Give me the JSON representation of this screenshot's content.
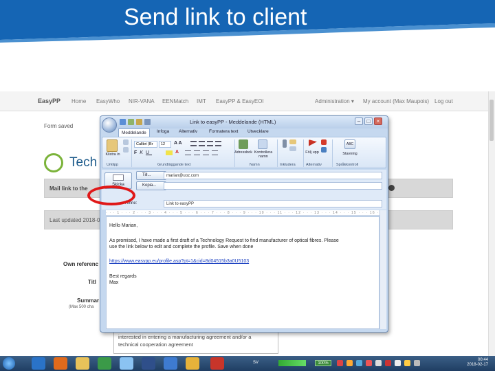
{
  "slide": {
    "title": "Send link to client",
    "colors": {
      "header_blue": "#1565b4",
      "header_light": "#4a90d0",
      "oval": "#e01818"
    }
  },
  "browser": {
    "brand": "EasyPP",
    "nav": [
      "Home",
      "EasyWho",
      "NIR-VANA",
      "EENMatch",
      "IMT",
      "EasyPP & EasyEOI",
      "Administration ▾",
      "My account (Max Maupois)",
      "Log out"
    ],
    "form_saved": "Form saved",
    "logo_text": "Tech",
    "mail_link": "Mail link to the",
    "last_updated": "Last updated 2018-0",
    "own_reference": "Own referenc",
    "title_label": "Titl",
    "summary_label": "Summar",
    "summary_hint": "(Max 500 cha",
    "summary_line1": "interested in entering a manufacturing agreement and/or a",
    "summary_line2": "technical cooperation agreement"
  },
  "outlook": {
    "title": "Link to easyPP - Meddelande (HTML)",
    "tabs": [
      "Meddelande",
      "Infoga",
      "Alternativ",
      "Formatera text",
      "Utvecklare"
    ],
    "ribbon": {
      "paste": "Klistra in",
      "font_name": "Calibri (Br",
      "font_size": "12",
      "addressbook": "Adressbok",
      "check_names": "Kontrollera namn",
      "followup": "Följ upp",
      "spelling": "Stavning",
      "groups": [
        "Urklipp",
        "Grundläggande text",
        "Namn",
        "Inkludera",
        "Alternativ",
        "Språkkontroll"
      ]
    },
    "header": {
      "send": "Skicka",
      "to_button": "Till...",
      "cc_button": "Kopia...",
      "subject_label": "Ämne:",
      "to_value": "marian@uoz.com",
      "cc_value": "",
      "subject_value": "Link to easyPP"
    },
    "body": {
      "greeting": "Hello Marian,",
      "line1": "As promised, I have made a first draft of a Technology Request to find manufacturer of optical fibres. Please",
      "line2": "use the link below to edit and complete the profile. Save when done",
      "link": "https://www.easypp.eu/profile.asp?pt=1&cid=8d04515b3a0U5103",
      "closing": "Best regards",
      "signature": "Max"
    }
  },
  "taskbar": {
    "zoom": "100%",
    "lang": "SV",
    "time": "00:44",
    "date": "2018-02-17"
  }
}
